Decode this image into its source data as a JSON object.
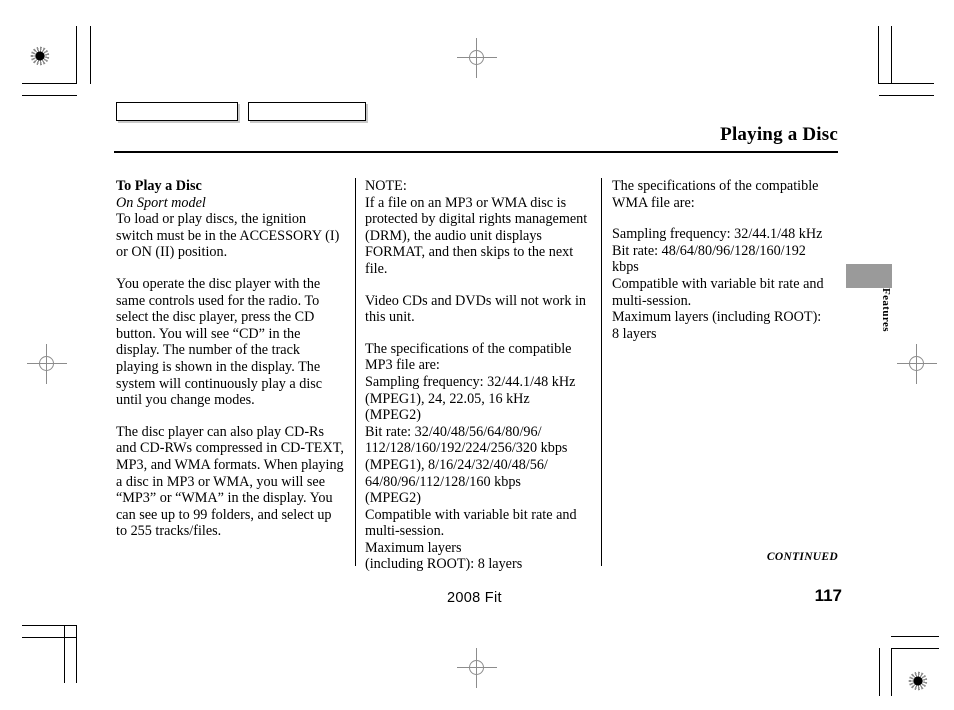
{
  "header": {
    "title": "Playing a Disc"
  },
  "side_tab": {
    "label": "Features"
  },
  "columns": {
    "column1": {
      "heading": "To Play a Disc",
      "subheading": "On Sport model",
      "paragraphs": [
        "To load or play discs, the ignition switch must be in the ACCESSORY (I) or ON (II) position.",
        "You operate the disc player with the same controls used for the radio. To select the disc player, press the CD button. You will see “CD” in the display. The number of the track playing is shown in the display. The system will continuously play a disc until you change modes.",
        "The disc player can also play CD-Rs and CD-RWs compressed in CD-TEXT, MP3, and WMA formats. When playing a disc in MP3 or WMA, you will see “MP3” or “WMA” in the display. You can see up to 99 folders, and select up to 255 tracks/files."
      ]
    },
    "column2": {
      "note_label": "NOTE:",
      "note_text": "If a file on an MP3 or WMA disc is protected by digital rights management (DRM), the audio unit displays FORMAT, and then skips to the next file.",
      "video_note": "Video CDs and DVDs will not work in this unit.",
      "spec_intro": "The specifications of the compatible MP3 file are:",
      "spec_lines": [
        "Sampling frequency: 32/44.1/48 kHz",
        "(MPEG1), 24, 22.05, 16 kHz",
        "(MPEG2)",
        "Bit rate: 32/40/48/56/64/80/96/",
        "112/128/160/192/224/256/320 kbps",
        "(MPEG1), 8/16/24/32/40/48/56/",
        "64/80/96/112/128/160 kbps",
        "(MPEG2)",
        "Compatible with variable bit rate and",
        "multi-session.",
        "Maximum layers",
        "(including ROOT): 8 layers"
      ]
    },
    "column3": {
      "spec_intro": "The specifications of the compatible WMA file are:",
      "spec_lines": [
        "Sampling frequency: 32/44.1/48 kHz",
        "Bit rate: 48/64/80/96/128/160/192",
        "kbps",
        "Compatible with variable bit rate and",
        "multi-session.",
        "Maximum layers (including ROOT):",
        "8 layers"
      ]
    }
  },
  "footer": {
    "continued": "CONTINUED",
    "model": "2008  Fit",
    "page_number": "117"
  }
}
